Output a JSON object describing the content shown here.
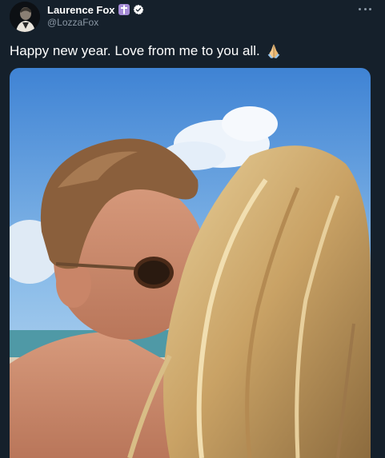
{
  "tweet": {
    "author": {
      "display_name": "Laurence Fox",
      "handle": "@LozzaFox",
      "badges": [
        "cross-icon",
        "verified-icon"
      ]
    },
    "text": "Happy new year. Love from me to you all.",
    "emoji": "folded-hands-icon",
    "menu_icon": "more-icon",
    "media": {
      "type": "photo"
    }
  },
  "colors": {
    "background": "#15202b",
    "primary_text": "#ffffff",
    "secondary_text": "#8b98a5",
    "badge_purple": "#a58bd6"
  }
}
